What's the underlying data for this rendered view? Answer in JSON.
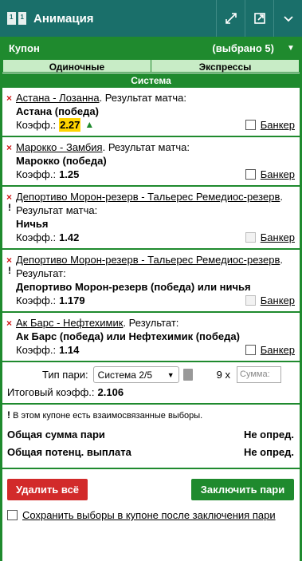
{
  "window": {
    "title": "Анимация",
    "buttons": [
      "expand-icon",
      "popout-icon",
      "chevron-down-icon"
    ]
  },
  "coupon": {
    "title": "Купон",
    "count": "(выбрано 5)",
    "tabs": [
      "Одиночные",
      "Экспрессы"
    ],
    "active_tab": "Система"
  },
  "selections": [
    {
      "event": "Астана - Лозанна",
      "market": ". Результат матча:",
      "pick": "Астана (победа)",
      "odds_label": "Коэфф.:",
      "odds": "2.27",
      "banker": "Банкер",
      "highlight": true,
      "warn": false
    },
    {
      "event": "Марокко - Замбия",
      "market": ". Результат матча:",
      "pick": "Марокко (победа)",
      "odds_label": "Коэфф.:",
      "odds": "1.25",
      "banker": "Банкер",
      "highlight": false,
      "warn": false
    },
    {
      "event": "Депортиво Морон-резерв - Тальерес Ремедиос-резерв",
      "market": ". Результат матча:",
      "pick": "Ничья",
      "odds_label": "Коэфф.:",
      "odds": "1.42",
      "banker": "Банкер",
      "highlight": false,
      "warn": true
    },
    {
      "event": "Депортиво Морон-резерв - Тальерес Ремедиос-резерв",
      "market": ". Результат:",
      "pick": "Депортиво Морон-резерв (победа) или ничья",
      "odds_label": "Коэфф.:",
      "odds": "1.179",
      "banker": "Банкер",
      "highlight": false,
      "warn": true
    },
    {
      "event": "Ак Барс - Нефтехимик",
      "market": ". Результат:",
      "pick": "Ак Барс (победа) или Нефтехимик (победа)",
      "odds_label": "Коэфф.:",
      "odds": "1.14",
      "banker": "Банкер",
      "highlight": false,
      "warn": false
    }
  ],
  "bet": {
    "type_label": "Тип пари:",
    "type_value": "Система 2/5",
    "multiplier": "9 x",
    "sum_placeholder": "Сумма:",
    "total_odds_label": "Итоговый коэфф.:",
    "total_odds": "2.106"
  },
  "warning": {
    "mark": "!",
    "text": "В этом купоне есть взаимосвязанные выборы."
  },
  "summary": {
    "total_stake_label": "Общая сумма пари",
    "total_stake_value": "Не опред.",
    "potential_payout_label": "Общая потенц. выплата",
    "potential_payout_value": "Не опред."
  },
  "actions": {
    "delete_all": "Удалить всё",
    "place_bet": "Заключить пари",
    "keep_selections": "Сохранить выборы в купоне после заключения пари"
  },
  "colors": {
    "header": "#1a6f6a",
    "accent_green": "#1f8a2e",
    "delete_red": "#d22a2a",
    "odds_highlight": "#ffd400"
  }
}
